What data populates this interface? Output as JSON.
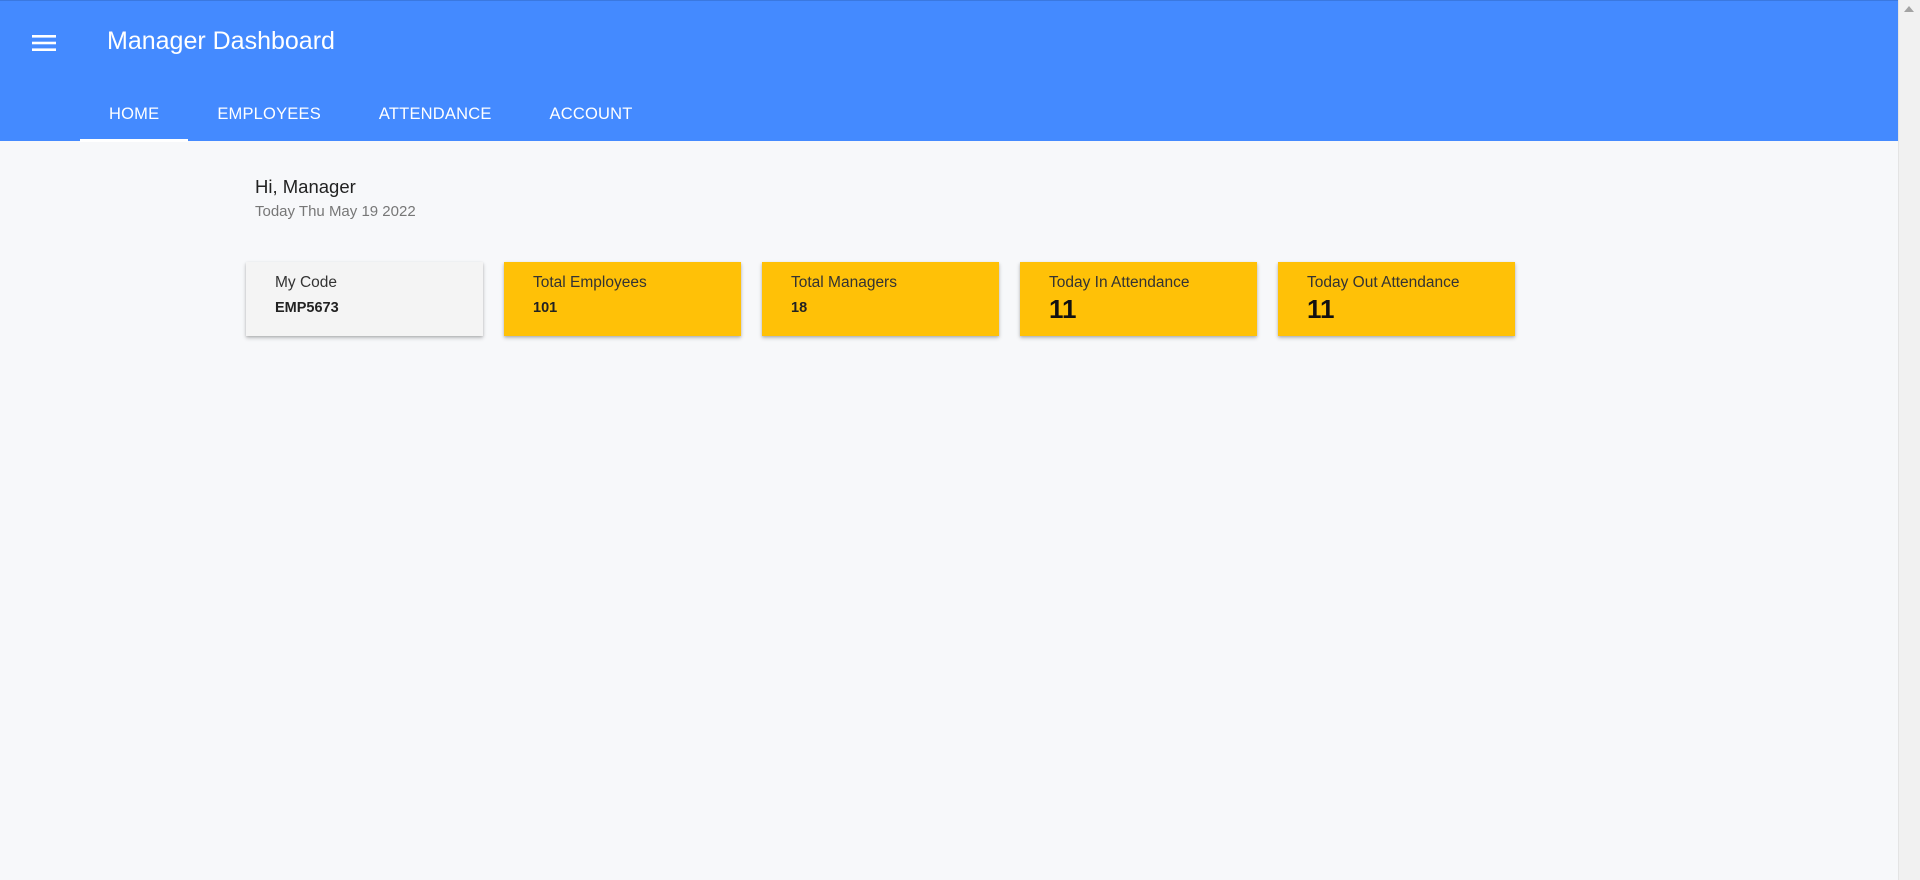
{
  "appbar": {
    "title": "Manager Dashboard",
    "menu_icon": "hamburger-menu-icon",
    "color": "#448aff"
  },
  "tabs": [
    {
      "label": "HOME",
      "active": true
    },
    {
      "label": "EMPLOYEES",
      "active": false
    },
    {
      "label": "ATTENDANCE",
      "active": false
    },
    {
      "label": "ACCOUNT",
      "active": false
    }
  ],
  "main": {
    "greeting": "Hi, Manager",
    "today": "Today Thu May 19 2022"
  },
  "cards": [
    {
      "label": "My Code",
      "value": "EMP5673",
      "color": "#f4f4f4"
    },
    {
      "label": "Total Employees",
      "value": "101",
      "color": "#ffc107"
    },
    {
      "label": "Total Managers",
      "value": "18",
      "color": "#ffc107"
    },
    {
      "label": "Today In Attendance",
      "value": "11",
      "color": "#ffc107"
    },
    {
      "label": "Today Out Attendance",
      "value": "11",
      "color": "#ffc107"
    }
  ]
}
